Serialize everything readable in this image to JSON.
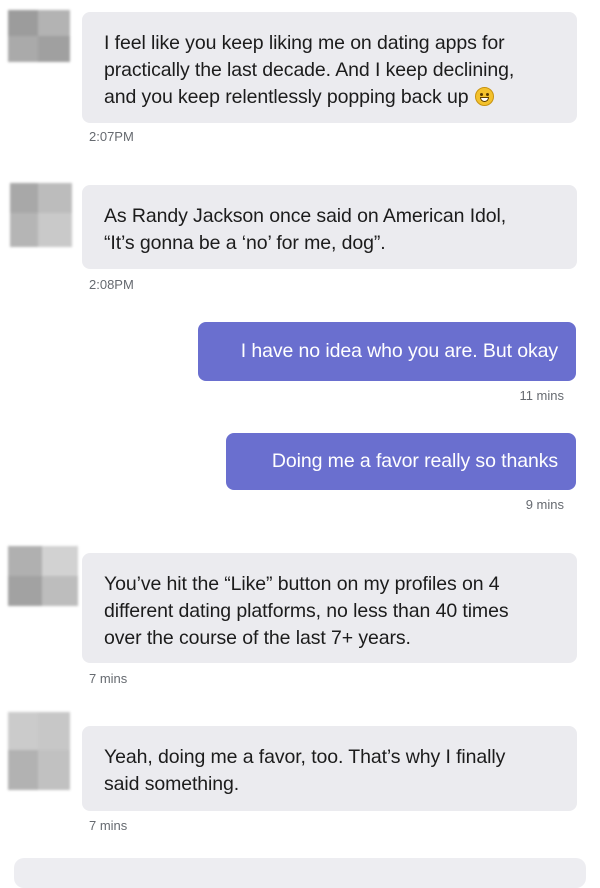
{
  "messages": [
    {
      "direction": "incoming",
      "lines": [
        "I feel like you keep liking me on dating apps for",
        "practically the last decade. And I keep declining,",
        "and you keep relentlessly popping back up"
      ],
      "emoji": "grinning-sweat-face",
      "time": "2:07PM"
    },
    {
      "direction": "incoming",
      "lines": [
        "As Randy Jackson once said on American Idol,",
        "“It’s gonna be a ‘no’ for me, dog”."
      ],
      "time": "2:08PM"
    },
    {
      "direction": "outgoing",
      "lines": [
        "I have no idea who you are. But okay"
      ],
      "time": "11 mins"
    },
    {
      "direction": "outgoing",
      "lines": [
        "Doing me a favor really so thanks"
      ],
      "time": "9 mins"
    },
    {
      "direction": "incoming",
      "lines": [
        "You’ve hit the “Like” button on my profiles on 4",
        "different dating platforms, no less than 40 times",
        "over the course of the last 7+ years."
      ],
      "time": "7 mins"
    },
    {
      "direction": "incoming",
      "lines": [
        "Yeah, doing me a favor, too. That’s why I finally",
        "said something."
      ],
      "time": "7 mins"
    }
  ],
  "colors": {
    "incoming_bubble": "#ebebef",
    "outgoing_bubble": "#6a6fcf",
    "timestamp": "#666a70"
  }
}
